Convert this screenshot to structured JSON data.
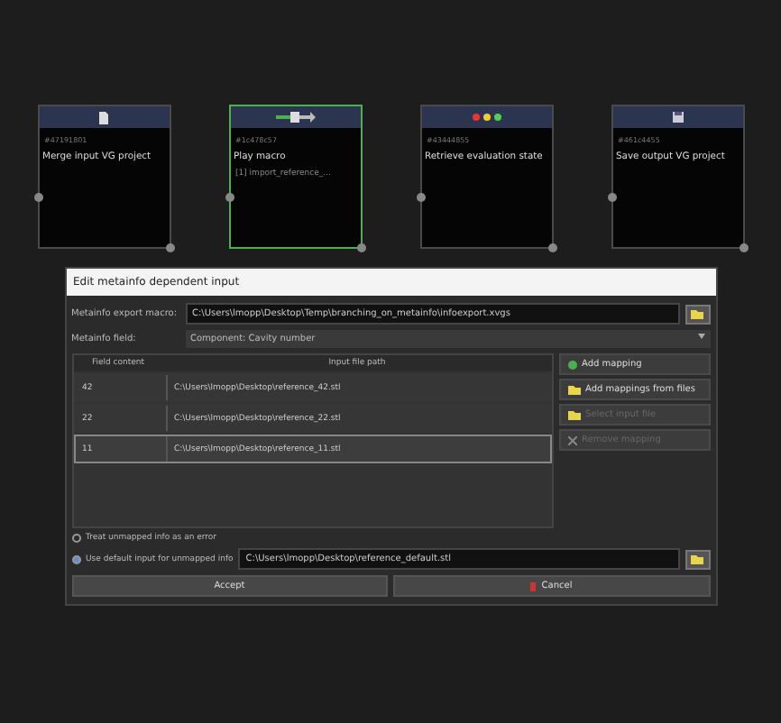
{
  "nodes": [
    {
      "id": "#47191801",
      "title": "Merge input VG project",
      "selected": false
    },
    {
      "id": "#1c478c57",
      "title": "Play macro",
      "detail": "[1] import_reference_...",
      "selected": true
    },
    {
      "id": "#43444855",
      "title": "Retrieve evaluation state",
      "selected": false
    },
    {
      "id": "#461c4455",
      "title": "Save output VG project",
      "selected": false
    }
  ],
  "dialog": {
    "title": "Edit metainfo dependent input",
    "macro_label": "Metainfo export macro:",
    "macro_value": "C:\\Users\\lmopp\\Desktop\\Temp\\branching_on_metainfo\\infoexport.xvgs",
    "field_label": "Metainfo field:",
    "field_value": "Component: Cavity number",
    "columns": [
      "Field content",
      "Input file path"
    ],
    "rows": [
      {
        "field": "42",
        "path": "C:\\Users\\lmopp\\Desktop\\reference_42.stl",
        "selected": false
      },
      {
        "field": "22",
        "path": "C:\\Users\\lmopp\\Desktop\\reference_22.stl",
        "selected": false
      },
      {
        "field": "11",
        "path": "C:\\Users\\lmopp\\Desktop\\reference_11.stl",
        "selected": true
      }
    ],
    "side_buttons": [
      {
        "label": "Add mapping",
        "disabled": false
      },
      {
        "label": "Add mappings from files",
        "disabled": false
      },
      {
        "label": "Select input file",
        "disabled": true
      },
      {
        "label": "Remove mapping",
        "disabled": true
      }
    ],
    "options": [
      {
        "label": "Treat unmapped info as an error",
        "selected": false
      },
      {
        "label": "Use default input for unmapped info",
        "selected": true
      }
    ],
    "default_path": "C:\\Users\\lmopp\\Desktop\\reference_default.stl",
    "accept": "Accept",
    "cancel": "Cancel"
  }
}
